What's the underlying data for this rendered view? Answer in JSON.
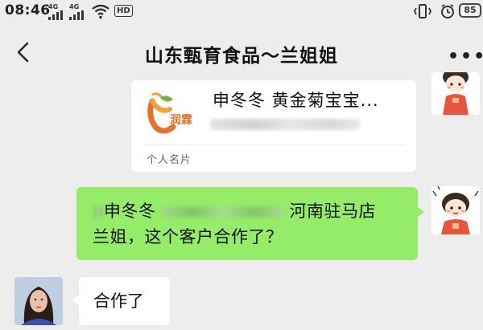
{
  "status_bar": {
    "time": "08:46",
    "signal_1_label": "4G",
    "signal_2_label": "4G",
    "hd_label": "HD",
    "battery": "85",
    "icons": [
      "signal-icon",
      "signal-icon",
      "wifi-icon",
      "hd-icon",
      "vibrate-icon",
      "alarm-icon",
      "battery-icon"
    ]
  },
  "header": {
    "title": "山东甄育食品～兰姐姐",
    "back_icon": "chevron-left-icon",
    "more_icon": "more-icon"
  },
  "messages": {
    "card": {
      "logo_text": "润霖",
      "name": "申冬冬  黄金菊宝宝...",
      "type_label": "个人名片"
    },
    "sent": {
      "part1": "申冬冬",
      "part2": "河南驻马店",
      "line2": "兰姐，这个客户合作了？"
    },
    "received": {
      "text": "合作了"
    }
  },
  "colors": {
    "background": "#ededed",
    "sent_bubble": "#95ec69",
    "received_bubble": "#ffffff"
  }
}
